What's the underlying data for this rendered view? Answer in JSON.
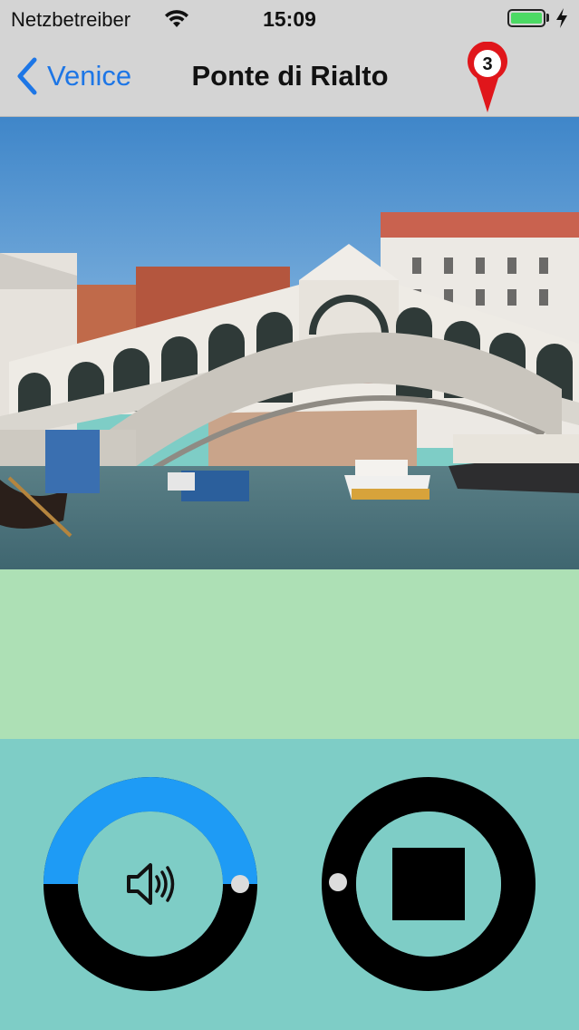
{
  "status_bar": {
    "carrier": "Netzbetreiber",
    "time": "15:09",
    "battery_level": 1.0,
    "battery_color": "#4cd964"
  },
  "nav": {
    "back_label": "Venice",
    "title": "Ponte di Rialto",
    "marker_number": "3",
    "marker_color": "#e0161b"
  },
  "content": {
    "photo_subject": "Rialto Bridge over the Grand Canal, Venice",
    "info_band_color": "#ade0b5"
  },
  "player": {
    "volume_icon": "speaker-icon",
    "volume_level": 0.5,
    "volume_arc_color": "#1e9bf5",
    "stop_icon": "stop-icon",
    "background_color": "#7ecdc6"
  }
}
